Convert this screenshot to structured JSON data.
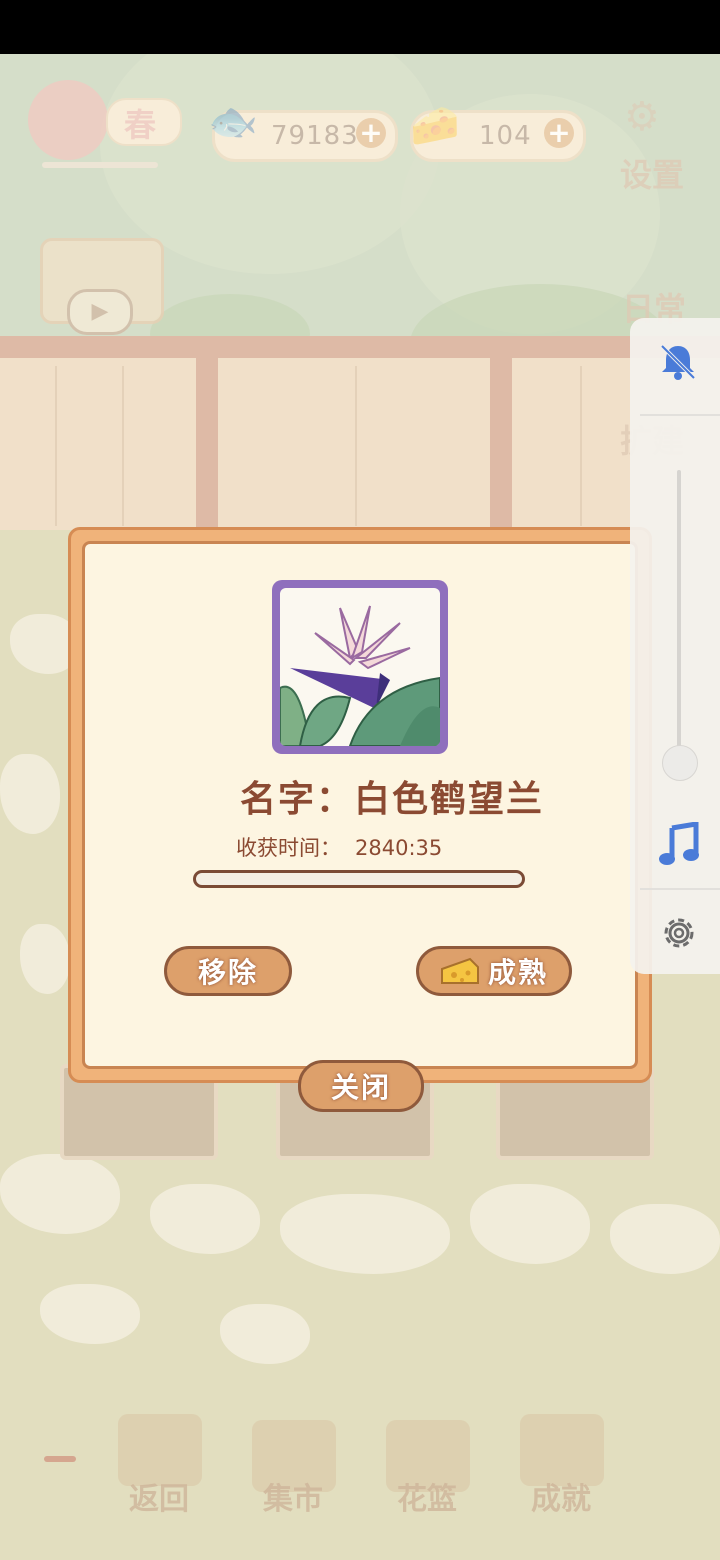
{
  "hud": {
    "season_label": "春",
    "fish_count": "79183",
    "cheese_count": "104",
    "plus_label": "+",
    "settings_label": "设置",
    "daily_label": "日常",
    "build_label": "扩建"
  },
  "dialog": {
    "plant_name": "名字：白色鹤望兰",
    "harvest_label": "收获时间：",
    "harvest_time": "2840:35",
    "progress": 0.0,
    "remove_label": "移除",
    "ripen_label": "成熟",
    "close_label": "关闭"
  },
  "bottom_nav": [
    {
      "label": "返回"
    },
    {
      "label": "集市"
    },
    {
      "label": "花篮"
    },
    {
      "label": "成就"
    }
  ],
  "side_panel": {
    "icons": [
      "bell-off-icon",
      "music-note-icon",
      "gear-icon"
    ],
    "accent": "#4a7bd8"
  }
}
